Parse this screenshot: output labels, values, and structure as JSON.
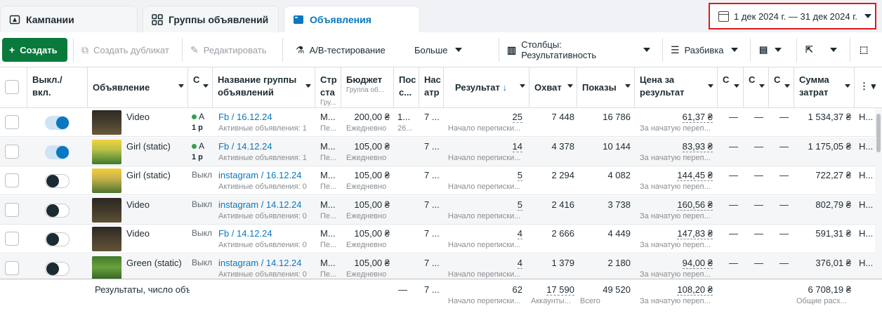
{
  "tabs": [
    {
      "label": "Кампании"
    },
    {
      "label": "Группы объявлений"
    },
    {
      "label": "Объявления"
    }
  ],
  "date_range": "1 дек 2024 г. — 31 дек 2024 г.",
  "toolbar": {
    "create": "Создать",
    "duplicate": "Создать дубликат",
    "edit": "Редактировать",
    "ab_test": "A/B-тестирование",
    "more": "Больше",
    "columns": "Столбцы: Результативность",
    "breakdown": "Разбивка"
  },
  "columns": {
    "toggle": "Выкл./ вкл.",
    "ad": "Объявление",
    "c": "С",
    "adset_name": "Название группы объявлений",
    "strategy": "Стр ста",
    "strategy_sub": "Гру...",
    "budget": "Бюджет",
    "budget_sub": "Группа об...",
    "last": "Пос с...",
    "attr": "Нас атр",
    "result": "Результат",
    "reach": "Охват",
    "impressions": "Показы",
    "cost": "Цена за результат",
    "c1": "С",
    "c2": "С",
    "c3": "С",
    "spend": "Сумма затрат"
  },
  "rows": [
    {
      "ad": "Video",
      "status": "А",
      "status2": "1 р",
      "adset": "Fb / 16.12.24",
      "adset_sub": "Активные объявления: 1",
      "strat": "М...",
      "strat_sub": "Пе...",
      "budget": "200,00 ₴",
      "budget_sub": "Ежедневно",
      "last": "1...",
      "last_sub": "26...",
      "attr": "7 ...",
      "result": "25",
      "result_sub": "Начало переписки...",
      "reach": "7 448",
      "impr": "16 786",
      "cost": "61,37 ₴",
      "cost_sub": "За начатую переп...",
      "d1": "—",
      "d2": "—",
      "d3": "—",
      "spend": "1 534,37 ₴",
      "more": "Н..."
    },
    {
      "ad": "Girl (static)",
      "status": "А",
      "status2": "1 р",
      "adset": "Fb / 14.12.24",
      "adset_sub": "Активные объявления: 1",
      "strat": "М...",
      "strat_sub": "Пе...",
      "budget": "105,00 ₴",
      "budget_sub": "Ежедневно",
      "last": "",
      "last_sub": "",
      "attr": "7 ...",
      "result": "14",
      "result_sub": "Начало переписки...",
      "reach": "4 378",
      "impr": "10 144",
      "cost": "83,93 ₴",
      "cost_sub": "За начатую переп...",
      "d1": "—",
      "d2": "—",
      "d3": "—",
      "spend": "1 175,05 ₴",
      "more": "Н..."
    },
    {
      "ad": "Girl (static)",
      "status": "Выкл",
      "status2": "",
      "adset": "instagram / 16.12.24",
      "adset_sub": "Активные объявления: 0",
      "strat": "М...",
      "strat_sub": "Пе...",
      "budget": "105,00 ₴",
      "budget_sub": "Ежедневно",
      "last": "",
      "last_sub": "",
      "attr": "7 ...",
      "result": "5",
      "result_sub": "Начало переписки...",
      "reach": "2 294",
      "impr": "4 082",
      "cost": "144,45 ₴",
      "cost_sub": "За начатую переп...",
      "d1": "—",
      "d2": "—",
      "d3": "—",
      "spend": "722,27 ₴",
      "more": "Н..."
    },
    {
      "ad": "Video",
      "status": "Выкл",
      "status2": "",
      "adset": "instagram / 14.12.24",
      "adset_sub": "Активные объявления: 0",
      "strat": "М...",
      "strat_sub": "Пе...",
      "budget": "105,00 ₴",
      "budget_sub": "Ежедневно",
      "last": "",
      "last_sub": "",
      "attr": "7 ...",
      "result": "5",
      "result_sub": "Начало переписки...",
      "reach": "2 416",
      "impr": "3 738",
      "cost": "160,56 ₴",
      "cost_sub": "За начатую переп...",
      "d1": "—",
      "d2": "—",
      "d3": "—",
      "spend": "802,79 ₴",
      "more": "Н..."
    },
    {
      "ad": "Video",
      "status": "Выкл",
      "status2": "",
      "adset": "Fb / 14.12.24",
      "adset_sub": "Активные объявления: 0",
      "strat": "М...",
      "strat_sub": "Пе...",
      "budget": "105,00 ₴",
      "budget_sub": "Ежедневно",
      "last": "",
      "last_sub": "",
      "attr": "7 ...",
      "result": "4",
      "result_sub": "Начало переписки...",
      "reach": "2 666",
      "impr": "4 449",
      "cost": "147,83 ₴",
      "cost_sub": "За начатую переп...",
      "d1": "—",
      "d2": "—",
      "d3": "—",
      "spend": "591,31 ₴",
      "more": "Н..."
    },
    {
      "ad": "Green (static)",
      "status": "Выкл",
      "status2": "",
      "adset": "instagram / 14.12.24",
      "adset_sub": "Активные объявления: 0",
      "strat": "М...",
      "strat_sub": "Пе...",
      "budget": "105,00 ₴",
      "budget_sub": "Ежедневно",
      "last": "",
      "last_sub": "",
      "attr": "7 ...",
      "result": "4",
      "result_sub": "Начало переписки...",
      "reach": "1 379",
      "impr": "2 180",
      "cost": "94,00 ₴",
      "cost_sub": "За начатую переп...",
      "d1": "—",
      "d2": "—",
      "d3": "—",
      "spend": "376,01 ₴",
      "more": "Н..."
    }
  ],
  "footer": {
    "label": "Результаты, число объ",
    "last": "—",
    "attr": "7 ...",
    "result": "62",
    "result_sub": "Начало переписки...",
    "reach": "17 590",
    "reach_sub": "Аккаунты...",
    "impr": "49 520",
    "impr_sub": "Всего",
    "cost": "108,20 ₴",
    "cost_sub": "За начатую переп...",
    "spend": "6 708,19 ₴",
    "spend_sub": "Общие расх..."
  },
  "toggle_states": [
    true,
    true,
    false,
    false,
    false,
    false
  ],
  "colors": {
    "accent": "#0a78be",
    "create": "#0a7a3c",
    "active_dot": "#31a24c",
    "highlight": "#e0171e"
  }
}
